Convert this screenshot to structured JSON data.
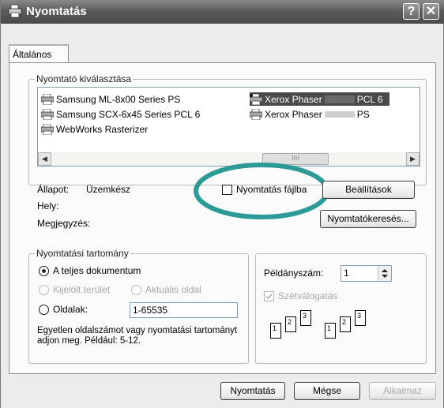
{
  "window": {
    "title": "Nyomtatás",
    "help_btn": "?",
    "close_btn": "✕"
  },
  "tab": {
    "label": "Általános"
  },
  "printer_group": {
    "label": "Nyomtató kiválasztása",
    "printers": [
      "Samsung ML-8x00 Series PS",
      "Samsung SCX-6x45 Series PCL 6",
      "WebWorks Rasterizer",
      "Xerox Phaser",
      "PCL 6",
      "Xerox Phaser",
      "PS"
    ],
    "scroll_left": "◀",
    "scroll_right": "▶",
    "scroll_grip": "IIII"
  },
  "status": {
    "state_label": "Állapot:",
    "state_value": "Üzemkész",
    "location_label": "Hely:",
    "comment_label": "Megjegyzés:",
    "print_to_file": "Nyomtatás fájlba",
    "settings_btn": "Beállítások",
    "find_printer_btn": "Nyomtatókeresés..."
  },
  "range_group": {
    "label": "Nyomtatási tartomány",
    "all": "A teljes dokumentum",
    "selection": "Kijelölt terület",
    "current": "Aktuális oldal",
    "pages": "Oldalak:",
    "pages_value": "1-65535",
    "help": "Egyetlen oldalszámot vagy nyomtatási tartományt adjon meg. Például: 5-12."
  },
  "copies_group": {
    "copies_label": "Példányszám:",
    "copies_value": "1",
    "collate": "Szétválogatás",
    "page_numbers": [
      "1",
      "2",
      "3",
      "1",
      "2",
      "3"
    ]
  },
  "footer": {
    "print_btn": "Nyomtatás",
    "cancel_btn": "Mégse",
    "apply_btn": "Alkalmaz"
  }
}
